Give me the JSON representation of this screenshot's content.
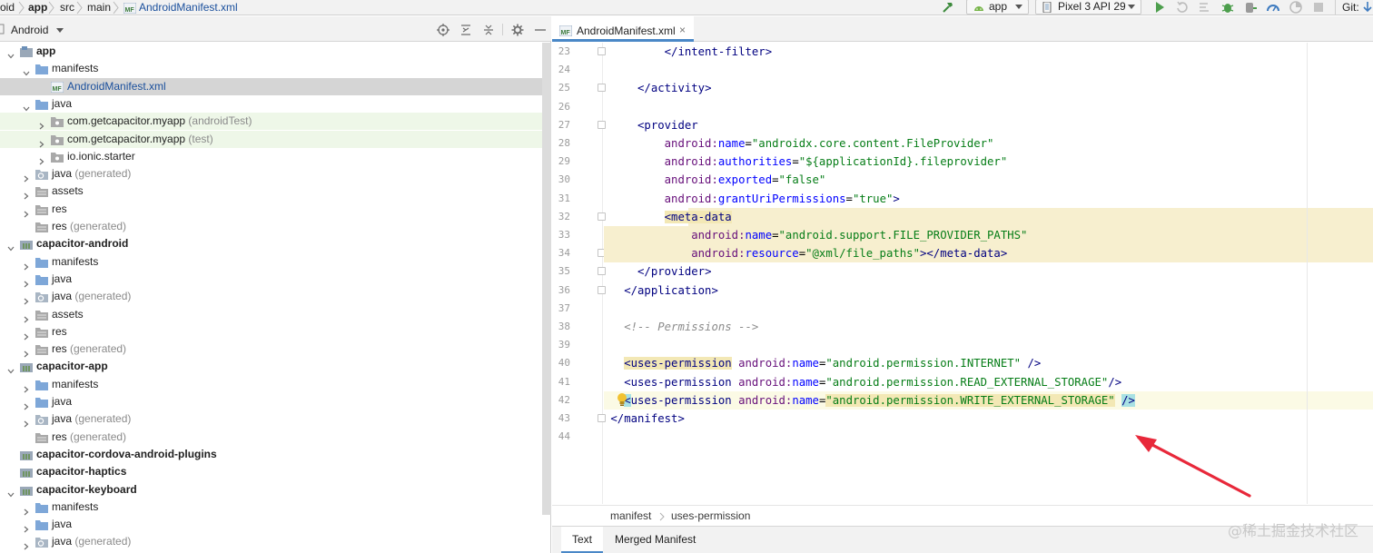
{
  "breadcrumb": {
    "items": [
      "oid",
      "app",
      "src",
      "main",
      "AndroidManifest.xml"
    ]
  },
  "toolbar": {
    "run_config": "app",
    "device": "Pixel 3 API 29",
    "git_label": "Git:"
  },
  "project_panel": {
    "view_mode": "Android",
    "tree": [
      {
        "depth": 0,
        "expanded": true,
        "icon": "module-icon",
        "name": "app",
        "suffix": "",
        "bold": true
      },
      {
        "depth": 1,
        "expanded": true,
        "icon": "folder-icon",
        "name": "manifests",
        "suffix": ""
      },
      {
        "depth": 2,
        "expanded": null,
        "icon": "manifest-file-icon",
        "name": "AndroidManifest.xml",
        "suffix": "",
        "selected": true
      },
      {
        "depth": 1,
        "expanded": true,
        "icon": "folder-icon",
        "name": "java",
        "suffix": ""
      },
      {
        "depth": 2,
        "expanded": false,
        "icon": "package-icon",
        "name": "com.getcapacitor.myapp",
        "suffix": "(androidTest)",
        "tint": "green"
      },
      {
        "depth": 2,
        "expanded": false,
        "icon": "package-icon",
        "name": "com.getcapacitor.myapp",
        "suffix": "(test)",
        "tint": "green"
      },
      {
        "depth": 2,
        "expanded": false,
        "icon": "package-icon",
        "name": "io.ionic.starter",
        "suffix": ""
      },
      {
        "depth": 1,
        "expanded": false,
        "icon": "generated-folder-icon",
        "name": "java",
        "suffix": "(generated)"
      },
      {
        "depth": 1,
        "expanded": false,
        "icon": "res-folder-icon",
        "name": "assets",
        "suffix": ""
      },
      {
        "depth": 1,
        "expanded": false,
        "icon": "res-folder-icon",
        "name": "res",
        "suffix": ""
      },
      {
        "depth": 1,
        "expanded": null,
        "icon": "res-folder-icon",
        "name": "res",
        "suffix": "(generated)"
      },
      {
        "depth": 0,
        "expanded": true,
        "icon": "library-module-icon",
        "name": "capacitor-android",
        "suffix": "",
        "bold": true
      },
      {
        "depth": 1,
        "expanded": false,
        "icon": "folder-icon",
        "name": "manifests",
        "suffix": ""
      },
      {
        "depth": 1,
        "expanded": false,
        "icon": "folder-icon",
        "name": "java",
        "suffix": ""
      },
      {
        "depth": 1,
        "expanded": false,
        "icon": "generated-folder-icon",
        "name": "java",
        "suffix": "(generated)"
      },
      {
        "depth": 1,
        "expanded": false,
        "icon": "res-folder-icon",
        "name": "assets",
        "suffix": ""
      },
      {
        "depth": 1,
        "expanded": false,
        "icon": "res-folder-icon",
        "name": "res",
        "suffix": ""
      },
      {
        "depth": 1,
        "expanded": false,
        "icon": "res-folder-icon",
        "name": "res",
        "suffix": "(generated)"
      },
      {
        "depth": 0,
        "expanded": true,
        "icon": "library-module-icon",
        "name": "capacitor-app",
        "suffix": "",
        "bold": true
      },
      {
        "depth": 1,
        "expanded": false,
        "icon": "folder-icon",
        "name": "manifests",
        "suffix": ""
      },
      {
        "depth": 1,
        "expanded": false,
        "icon": "folder-icon",
        "name": "java",
        "suffix": ""
      },
      {
        "depth": 1,
        "expanded": false,
        "icon": "generated-folder-icon",
        "name": "java",
        "suffix": "(generated)"
      },
      {
        "depth": 1,
        "expanded": null,
        "icon": "res-folder-icon",
        "name": "res",
        "suffix": "(generated)"
      },
      {
        "depth": 0,
        "expanded": null,
        "icon": "library-module-icon",
        "name": "capacitor-cordova-android-plugins",
        "suffix": "",
        "bold": true
      },
      {
        "depth": 0,
        "expanded": null,
        "icon": "library-module-icon",
        "name": "capacitor-haptics",
        "suffix": "",
        "bold": true
      },
      {
        "depth": 0,
        "expanded": true,
        "icon": "library-module-icon",
        "name": "capacitor-keyboard",
        "suffix": "",
        "bold": true
      },
      {
        "depth": 1,
        "expanded": false,
        "icon": "folder-icon",
        "name": "manifests",
        "suffix": ""
      },
      {
        "depth": 1,
        "expanded": false,
        "icon": "folder-icon",
        "name": "java",
        "suffix": ""
      },
      {
        "depth": 1,
        "expanded": false,
        "icon": "generated-folder-icon",
        "name": "java",
        "suffix": "(generated)"
      }
    ]
  },
  "editor": {
    "tab_label": "AndroidManifest.xml",
    "tab_close": "×",
    "lines": [
      {
        "n": "23",
        "fold": true,
        "segs": [
          [
            "p",
            "        "
          ],
          [
            "tag",
            "</intent-filter>"
          ]
        ]
      },
      {
        "n": "24",
        "segs": []
      },
      {
        "n": "25",
        "fold": true,
        "segs": [
          [
            "p",
            "    "
          ],
          [
            "tag",
            "</activity>"
          ]
        ]
      },
      {
        "n": "26",
        "segs": []
      },
      {
        "n": "27",
        "fold": true,
        "segs": [
          [
            "p",
            "    "
          ],
          [
            "tag",
            "<provider"
          ]
        ]
      },
      {
        "n": "28",
        "segs": [
          [
            "p",
            "        "
          ],
          [
            "ns",
            "android:"
          ],
          [
            "attr",
            "name"
          ],
          [
            "p",
            "="
          ],
          [
            "val",
            "\"androidx.core.content.FileProvider\""
          ]
        ]
      },
      {
        "n": "29",
        "segs": [
          [
            "p",
            "        "
          ],
          [
            "ns",
            "android:"
          ],
          [
            "attr",
            "authorities"
          ],
          [
            "p",
            "="
          ],
          [
            "val",
            "\"${applicationId}.fileprovider\""
          ]
        ]
      },
      {
        "n": "30",
        "segs": [
          [
            "p",
            "        "
          ],
          [
            "ns",
            "android:"
          ],
          [
            "attr",
            "exported"
          ],
          [
            "p",
            "="
          ],
          [
            "val",
            "\"false\""
          ]
        ]
      },
      {
        "n": "31",
        "segs": [
          [
            "p",
            "        "
          ],
          [
            "ns",
            "android:"
          ],
          [
            "attr",
            "grantUriPermissions"
          ],
          [
            "p",
            "="
          ],
          [
            "val",
            "\"true\""
          ],
          [
            "tag",
            ">"
          ]
        ]
      },
      {
        "n": "32",
        "fold": true,
        "hl": "partial",
        "segs": [
          [
            "p",
            "        "
          ],
          [
            "tagh",
            "<meta-data"
          ]
        ]
      },
      {
        "n": "33",
        "hl": "full",
        "segs": [
          [
            "p",
            "            "
          ],
          [
            "ns",
            "android:"
          ],
          [
            "attr",
            "name"
          ],
          [
            "p",
            "="
          ],
          [
            "val",
            "\"android.support.FILE_PROVIDER_PATHS\""
          ]
        ]
      },
      {
        "n": "34",
        "fold": true,
        "hl": "full",
        "segs": [
          [
            "p",
            "            "
          ],
          [
            "ns",
            "android:"
          ],
          [
            "attr",
            "resource"
          ],
          [
            "p",
            "="
          ],
          [
            "val",
            "\"@xml/file_paths\""
          ],
          [
            "tag",
            "></meta-data>"
          ]
        ]
      },
      {
        "n": "35",
        "fold": true,
        "segs": [
          [
            "p",
            "    "
          ],
          [
            "tag",
            "</provider>"
          ]
        ]
      },
      {
        "n": "36",
        "fold": true,
        "segs": [
          [
            "p",
            "  "
          ],
          [
            "tag",
            "</application>"
          ]
        ]
      },
      {
        "n": "37",
        "segs": []
      },
      {
        "n": "38",
        "segs": [
          [
            "p",
            "  "
          ],
          [
            "cm",
            "<!-- Permissions -->"
          ]
        ]
      },
      {
        "n": "39",
        "segs": []
      },
      {
        "n": "40",
        "segs": [
          [
            "p",
            "  "
          ],
          [
            "tagw",
            "<uses-permission"
          ],
          [
            "p",
            " "
          ],
          [
            "ns",
            "android:"
          ],
          [
            "attr",
            "name"
          ],
          [
            "p",
            "="
          ],
          [
            "val",
            "\"android.permission.INTERNET\""
          ],
          [
            "tag",
            " />"
          ]
        ]
      },
      {
        "n": "41",
        "segs": [
          [
            "p",
            "  "
          ],
          [
            "tag",
            "<uses-permission"
          ],
          [
            "p",
            " "
          ],
          [
            "ns",
            "android:"
          ],
          [
            "attr",
            "name"
          ],
          [
            "p",
            "="
          ],
          [
            "val",
            "\"android.permission.READ_EXTERNAL_STORAGE\""
          ],
          [
            "tag",
            "/>"
          ]
        ]
      },
      {
        "n": "42",
        "cur": true,
        "segs": [
          [
            "p",
            "  "
          ],
          [
            "tagt",
            "<"
          ],
          [
            "tag",
            "uses-permission"
          ],
          [
            "p",
            " "
          ],
          [
            "ns",
            "android:"
          ],
          [
            "attr",
            "name"
          ],
          [
            "p",
            "="
          ],
          [
            "valw",
            "\"android.permission.WRITE_EXTERNAL_STORAGE\""
          ],
          [
            "p",
            " "
          ],
          [
            "tagt",
            "/>"
          ]
        ]
      },
      {
        "n": "43",
        "fold": true,
        "segs": [
          [
            "tag",
            "</manifest>"
          ]
        ]
      },
      {
        "n": "44",
        "segs": []
      }
    ],
    "bottom_breadcrumb": [
      "manifest",
      "uses-permission"
    ],
    "bottom_tabs": [
      "Text",
      "Merged Manifest"
    ],
    "active_bottom_tab": "Text"
  },
  "watermark": "@稀土掘金技术社区",
  "colors": {
    "accent": "#4a88c7",
    "selection": "#d5d5d5",
    "highlight": "#f7efcf",
    "arrow": "#e8283a"
  }
}
